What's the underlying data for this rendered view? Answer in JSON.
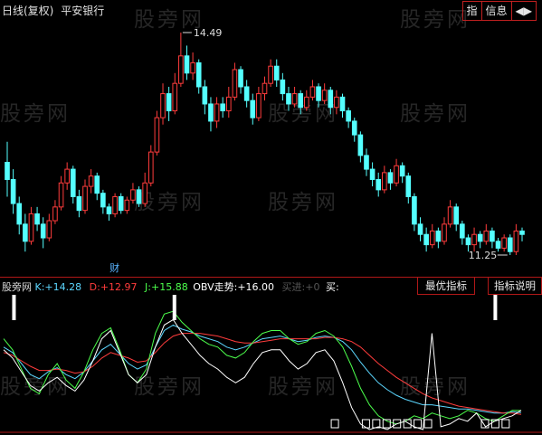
{
  "header": {
    "period_label": "日线(复权)",
    "stock_name": "平安银行",
    "buttons": [
      "指",
      "信息",
      "◀▶"
    ]
  },
  "watermark": "股旁网",
  "price_chart": {
    "type": "candlestick",
    "high_label": "14.49",
    "low_label": "11.25",
    "marker": "财",
    "colors": {
      "up": "#ff3c3c",
      "down": "#54ffff"
    },
    "bars": [
      {
        "o": 12.6,
        "c": 12.35,
        "h": 12.9,
        "l": 12.1
      },
      {
        "o": 12.35,
        "c": 12.0,
        "h": 12.5,
        "l": 11.85
      },
      {
        "o": 12.0,
        "c": 11.7,
        "h": 12.1,
        "l": 11.55
      },
      {
        "o": 11.7,
        "c": 11.45,
        "h": 11.85,
        "l": 11.3
      },
      {
        "o": 11.45,
        "c": 11.85,
        "h": 11.95,
        "l": 11.4
      },
      {
        "o": 11.85,
        "c": 11.7,
        "h": 11.95,
        "l": 11.6
      },
      {
        "o": 11.7,
        "c": 11.5,
        "h": 11.8,
        "l": 11.35
      },
      {
        "o": 11.5,
        "c": 11.75,
        "h": 11.85,
        "l": 11.45
      },
      {
        "o": 11.75,
        "c": 11.95,
        "h": 12.05,
        "l": 11.7
      },
      {
        "o": 11.95,
        "c": 12.3,
        "h": 12.4,
        "l": 11.9
      },
      {
        "o": 12.3,
        "c": 12.5,
        "h": 12.6,
        "l": 12.2
      },
      {
        "o": 12.5,
        "c": 12.1,
        "h": 12.55,
        "l": 12.0
      },
      {
        "o": 12.1,
        "c": 11.9,
        "h": 12.2,
        "l": 11.8
      },
      {
        "o": 11.9,
        "c": 12.25,
        "h": 12.35,
        "l": 11.85
      },
      {
        "o": 12.25,
        "c": 12.4,
        "h": 12.5,
        "l": 12.15
      },
      {
        "o": 12.4,
        "c": 12.15,
        "h": 12.45,
        "l": 12.05
      },
      {
        "o": 12.15,
        "c": 11.95,
        "h": 12.2,
        "l": 11.85
      },
      {
        "o": 11.95,
        "c": 11.85,
        "h": 12.0,
        "l": 11.75
      },
      {
        "o": 11.85,
        "c": 12.1,
        "h": 12.15,
        "l": 11.8
      },
      {
        "o": 12.1,
        "c": 11.9,
        "h": 12.15,
        "l": 11.85
      },
      {
        "o": 11.9,
        "c": 12.05,
        "h": 12.1,
        "l": 11.85
      },
      {
        "o": 12.05,
        "c": 12.2,
        "h": 12.3,
        "l": 12.0
      },
      {
        "o": 12.2,
        "c": 12.0,
        "h": 12.25,
        "l": 11.95
      },
      {
        "o": 12.0,
        "c": 12.3,
        "h": 12.45,
        "l": 11.95
      },
      {
        "o": 12.3,
        "c": 12.75,
        "h": 12.85,
        "l": 12.25
      },
      {
        "o": 12.75,
        "c": 13.25,
        "h": 13.35,
        "l": 12.7
      },
      {
        "o": 13.25,
        "c": 13.6,
        "h": 13.75,
        "l": 13.15
      },
      {
        "o": 13.6,
        "c": 13.35,
        "h": 13.7,
        "l": 13.2
      },
      {
        "o": 13.35,
        "c": 13.75,
        "h": 13.9,
        "l": 13.3
      },
      {
        "o": 13.75,
        "c": 14.15,
        "h": 14.49,
        "l": 13.7
      },
      {
        "o": 14.15,
        "c": 13.9,
        "h": 14.3,
        "l": 13.8
      },
      {
        "o": 13.9,
        "c": 14.05,
        "h": 14.2,
        "l": 13.8
      },
      {
        "o": 14.05,
        "c": 13.7,
        "h": 14.1,
        "l": 13.6
      },
      {
        "o": 13.7,
        "c": 13.45,
        "h": 13.8,
        "l": 13.3
      },
      {
        "o": 13.45,
        "c": 13.2,
        "h": 13.55,
        "l": 13.05
      },
      {
        "o": 13.2,
        "c": 13.45,
        "h": 13.55,
        "l": 13.1
      },
      {
        "o": 13.45,
        "c": 13.35,
        "h": 13.55,
        "l": 13.25
      },
      {
        "o": 13.35,
        "c": 13.55,
        "h": 13.7,
        "l": 13.25
      },
      {
        "o": 13.55,
        "c": 13.95,
        "h": 14.05,
        "l": 13.5
      },
      {
        "o": 13.95,
        "c": 13.7,
        "h": 14.0,
        "l": 13.6
      },
      {
        "o": 13.7,
        "c": 13.5,
        "h": 13.8,
        "l": 13.4
      },
      {
        "o": 13.5,
        "c": 13.25,
        "h": 13.6,
        "l": 13.15
      },
      {
        "o": 13.25,
        "c": 13.6,
        "h": 13.7,
        "l": 13.2
      },
      {
        "o": 13.6,
        "c": 13.75,
        "h": 13.85,
        "l": 13.5
      },
      {
        "o": 13.75,
        "c": 14.0,
        "h": 14.1,
        "l": 13.7
      },
      {
        "o": 14.0,
        "c": 13.8,
        "h": 14.1,
        "l": 13.7
      },
      {
        "o": 13.8,
        "c": 13.6,
        "h": 13.9,
        "l": 13.5
      },
      {
        "o": 13.6,
        "c": 13.45,
        "h": 13.7,
        "l": 13.35
      },
      {
        "o": 13.45,
        "c": 13.6,
        "h": 13.7,
        "l": 13.4
      },
      {
        "o": 13.6,
        "c": 13.4,
        "h": 13.65,
        "l": 13.3
      },
      {
        "o": 13.4,
        "c": 13.55,
        "h": 13.65,
        "l": 13.35
      },
      {
        "o": 13.55,
        "c": 13.7,
        "h": 13.8,
        "l": 13.5
      },
      {
        "o": 13.7,
        "c": 13.5,
        "h": 13.75,
        "l": 13.4
      },
      {
        "o": 13.5,
        "c": 13.65,
        "h": 13.75,
        "l": 13.45
      },
      {
        "o": 13.65,
        "c": 13.4,
        "h": 13.7,
        "l": 13.3
      },
      {
        "o": 13.4,
        "c": 13.55,
        "h": 13.65,
        "l": 13.3
      },
      {
        "o": 13.55,
        "c": 13.35,
        "h": 13.6,
        "l": 13.25
      },
      {
        "o": 13.35,
        "c": 13.2,
        "h": 13.4,
        "l": 13.1
      },
      {
        "o": 13.2,
        "c": 13.0,
        "h": 13.25,
        "l": 12.9
      },
      {
        "o": 13.0,
        "c": 12.7,
        "h": 13.05,
        "l": 12.6
      },
      {
        "o": 12.7,
        "c": 12.5,
        "h": 12.8,
        "l": 12.4
      },
      {
        "o": 12.5,
        "c": 12.35,
        "h": 12.6,
        "l": 12.25
      },
      {
        "o": 12.35,
        "c": 12.2,
        "h": 12.45,
        "l": 12.1
      },
      {
        "o": 12.2,
        "c": 12.45,
        "h": 12.55,
        "l": 12.15
      },
      {
        "o": 12.45,
        "c": 12.3,
        "h": 12.5,
        "l": 12.2
      },
      {
        "o": 12.3,
        "c": 12.55,
        "h": 12.65,
        "l": 12.25
      },
      {
        "o": 12.55,
        "c": 12.4,
        "h": 12.6,
        "l": 12.3
      },
      {
        "o": 12.4,
        "c": 12.1,
        "h": 12.45,
        "l": 12.0
      },
      {
        "o": 12.1,
        "c": 11.7,
        "h": 12.15,
        "l": 11.6
      },
      {
        "o": 11.7,
        "c": 11.55,
        "h": 11.8,
        "l": 11.45
      },
      {
        "o": 11.55,
        "c": 11.4,
        "h": 11.65,
        "l": 11.3
      },
      {
        "o": 11.4,
        "c": 11.6,
        "h": 11.7,
        "l": 11.35
      },
      {
        "o": 11.6,
        "c": 11.45,
        "h": 11.65,
        "l": 11.35
      },
      {
        "o": 11.45,
        "c": 11.7,
        "h": 11.8,
        "l": 11.4
      },
      {
        "o": 11.7,
        "c": 11.95,
        "h": 12.05,
        "l": 11.65
      },
      {
        "o": 11.95,
        "c": 11.7,
        "h": 12.0,
        "l": 11.6
      },
      {
        "o": 11.7,
        "c": 11.5,
        "h": 11.75,
        "l": 11.4
      },
      {
        "o": 11.5,
        "c": 11.4,
        "h": 11.55,
        "l": 11.3
      },
      {
        "o": 11.4,
        "c": 11.55,
        "h": 11.65,
        "l": 11.3
      },
      {
        "o": 11.55,
        "c": 11.45,
        "h": 11.6,
        "l": 11.35
      },
      {
        "o": 11.45,
        "c": 11.6,
        "h": 11.7,
        "l": 11.4
      },
      {
        "o": 11.6,
        "c": 11.45,
        "h": 11.65,
        "l": 11.35
      },
      {
        "o": 11.45,
        "c": 11.35,
        "h": 11.5,
        "l": 11.3
      },
      {
        "o": 11.35,
        "c": 11.5,
        "h": 11.55,
        "l": 11.3
      },
      {
        "o": 11.5,
        "c": 11.3,
        "h": 11.55,
        "l": 11.25
      },
      {
        "o": 11.3,
        "c": 11.6,
        "h": 11.7,
        "l": 11.25
      },
      {
        "o": 11.6,
        "c": 11.55,
        "h": 11.65,
        "l": 11.45
      }
    ]
  },
  "indicator": {
    "name": "股旁网",
    "k_label": "K:",
    "k_value": "+14.28",
    "d_label": "D:",
    "d_value": "+12.97",
    "j_label": "J:",
    "j_value": "+15.88",
    "obv_label": "OBV走势:",
    "obv_value": "+16.00",
    "extra_label": "买进:",
    "extra_value": "+0",
    "buy_label": "买:",
    "buttons": {
      "best": "最优指标",
      "help": "指标说明"
    },
    "colors": {
      "k": "#5cd7ff",
      "d": "#ff3c3c",
      "j": "#4cff4c",
      "obv": "#ffffff"
    }
  },
  "chart_data": {
    "type": "line",
    "series": [
      {
        "name": "K",
        "values": [
          62,
          58,
          50,
          42,
          39,
          44,
          47,
          42,
          39,
          44,
          52,
          60,
          64,
          57,
          50,
          46,
          49,
          62,
          74,
          78,
          75,
          73,
          70,
          68,
          66,
          62,
          60,
          62,
          65,
          68,
          69,
          70,
          68,
          66,
          67,
          69,
          70,
          69,
          66,
          60,
          51,
          43,
          36,
          31,
          27,
          24,
          22,
          20,
          20,
          19,
          18,
          17,
          17,
          16,
          15,
          14,
          14,
          15,
          14.28
        ]
      },
      {
        "name": "D",
        "values": [
          58,
          56,
          52,
          48,
          45,
          45,
          46,
          45,
          43,
          44,
          48,
          54,
          58,
          56,
          54,
          51,
          52,
          58,
          65,
          70,
          72,
          72,
          72,
          71,
          70,
          68,
          66,
          65,
          65,
          66,
          67,
          68,
          68,
          68,
          68,
          68,
          69,
          69,
          68,
          66,
          62,
          56,
          50,
          45,
          40,
          36,
          32,
          28,
          25,
          23,
          21,
          19,
          18,
          17,
          16,
          15,
          14,
          14,
          12.97
        ]
      },
      {
        "name": "J",
        "values": [
          68,
          60,
          46,
          32,
          28,
          42,
          50,
          38,
          32,
          44,
          60,
          72,
          76,
          60,
          42,
          36,
          46,
          72,
          86,
          88,
          80,
          74,
          68,
          64,
          62,
          56,
          54,
          58,
          66,
          72,
          74,
          74,
          68,
          64,
          66,
          72,
          74,
          70,
          62,
          48,
          32,
          20,
          12,
          8,
          6,
          8,
          12,
          10,
          14,
          12,
          10,
          12,
          16,
          14,
          10,
          8,
          12,
          16,
          15.88
        ]
      },
      {
        "name": "OBV走势",
        "values": [
          60,
          54,
          44,
          34,
          30,
          36,
          40,
          34,
          30,
          38,
          52,
          68,
          74,
          58,
          42,
          36,
          42,
          62,
          78,
          82,
          72,
          64,
          56,
          50,
          46,
          40,
          36,
          40,
          50,
          58,
          60,
          60,
          52,
          46,
          50,
          58,
          60,
          52,
          36,
          18,
          6,
          2,
          4,
          2,
          6,
          8,
          4,
          2,
          72,
          4,
          6,
          10,
          8,
          14,
          4,
          8,
          10,
          12,
          16.0
        ]
      }
    ],
    "signals_top": [
      2,
      33,
      95
    ],
    "signals_bottom_boxes": [
      64,
      70,
      72,
      74,
      76,
      78,
      80,
      82,
      93,
      95,
      97
    ]
  }
}
